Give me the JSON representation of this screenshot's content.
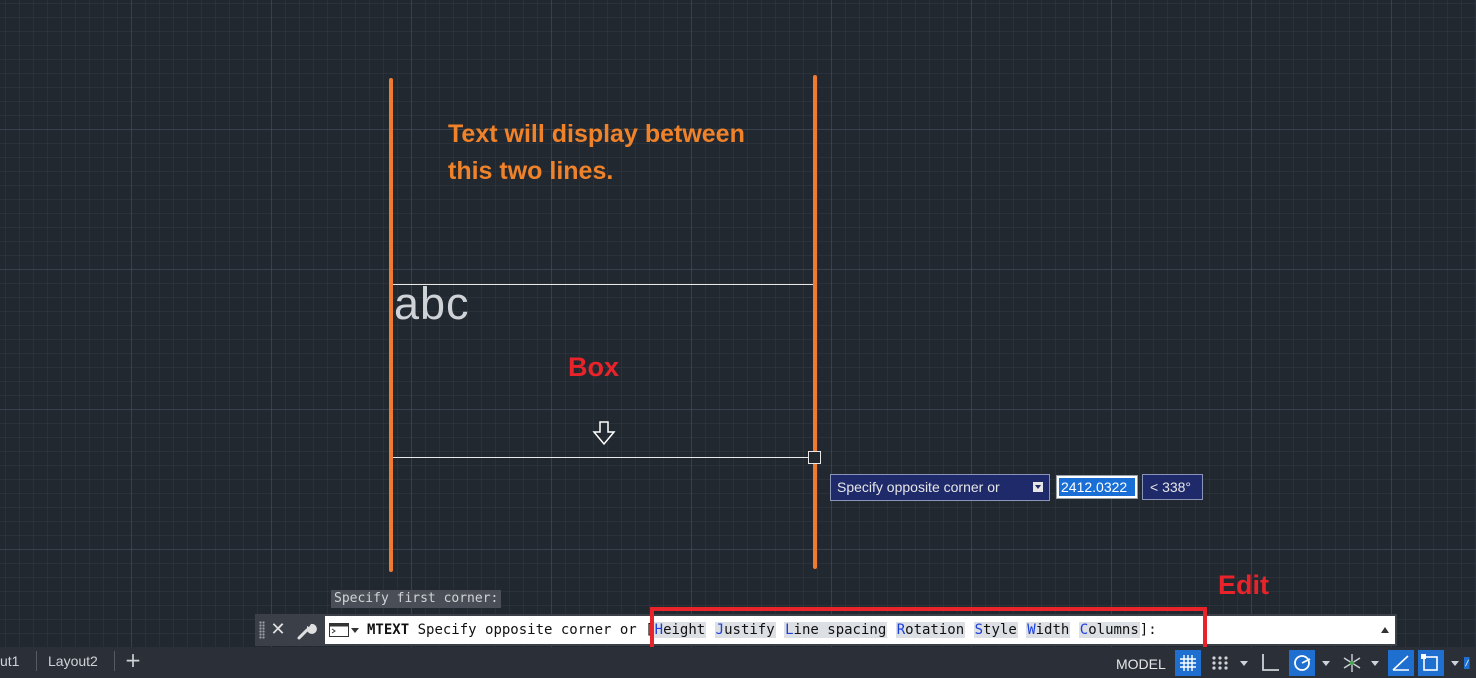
{
  "canvas": {
    "annotation_note": [
      "Text will display between",
      "this two lines."
    ],
    "annotation_box": "Box",
    "annotation_edit": "Edit",
    "preview_text": "abc"
  },
  "dynamic_input": {
    "prompt": "Specify opposite corner or",
    "value": "2412.0322",
    "angle": "< 338°"
  },
  "command_line": {
    "history": "Specify first corner:",
    "command": "MTEXT",
    "prompt": "Specify opposite corner or",
    "options": [
      {
        "key": "H",
        "rest": "eight"
      },
      {
        "key": "J",
        "rest": "ustify"
      },
      {
        "key": "L",
        "rest": "ine spacing"
      },
      {
        "key": "R",
        "rest": "otation"
      },
      {
        "key": "S",
        "rest": "tyle"
      },
      {
        "key": "W",
        "rest": "idth"
      },
      {
        "key": "C",
        "rest": "olumns"
      }
    ],
    "bracket_open": "[",
    "bracket_close": "]:"
  },
  "status_bar": {
    "tabs": [
      "ut1",
      "Layout2"
    ],
    "add_tab": "+",
    "model": "MODEL"
  },
  "colors": {
    "accent_orange": "#f07a30",
    "annotation_red": "#e8232a",
    "active_blue": "#1f6fd0"
  }
}
